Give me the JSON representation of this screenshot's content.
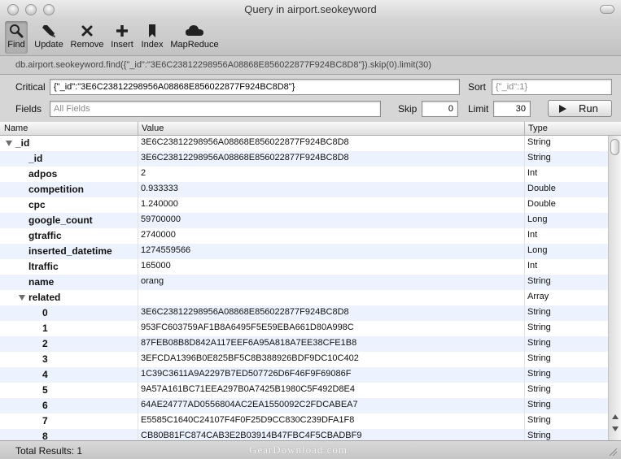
{
  "window": {
    "title": "Query in airport.seokeyword"
  },
  "toolbar": {
    "find": "Find",
    "update": "Update",
    "remove": "Remove",
    "insert": "Insert",
    "index": "Index",
    "mapreduce": "MapReduce"
  },
  "query_line": "db.airport.seokeyword.find({\"_id\":\"3E6C23812298956A08868E856022877F924BC8D8\"}).skip(0).limit(30)",
  "form": {
    "critical_label": "Critical",
    "critical_value": "{\"_id\":\"3E6C23812298956A08868E856022877F924BC8D8\"}",
    "sort_label": "Sort",
    "sort_placeholder": "{\"_id\":1}",
    "fields_label": "Fields",
    "fields_placeholder": "All Fields",
    "skip_label": "Skip",
    "skip_value": "0",
    "limit_label": "Limit",
    "limit_value": "30",
    "run_label": "Run"
  },
  "table": {
    "headers": {
      "name": "Name",
      "value": "Value",
      "type": "Type"
    },
    "rows": [
      {
        "name": "_id",
        "value": "3E6C23812298956A08868E856022877F924BC8D8",
        "type": "String",
        "level": 0,
        "expanded": true
      },
      {
        "name": "_id",
        "value": "3E6C23812298956A08868E856022877F924BC8D8",
        "type": "String",
        "level": 1
      },
      {
        "name": "adpos",
        "value": "2",
        "type": "Int",
        "level": 1
      },
      {
        "name": "competition",
        "value": "0.933333",
        "type": "Double",
        "level": 1
      },
      {
        "name": "cpc",
        "value": "1.240000",
        "type": "Double",
        "level": 1
      },
      {
        "name": "google_count",
        "value": "59700000",
        "type": "Long",
        "level": 1
      },
      {
        "name": "gtraffic",
        "value": "2740000",
        "type": "Int",
        "level": 1
      },
      {
        "name": "inserted_datetime",
        "value": "1274559566",
        "type": "Long",
        "level": 1
      },
      {
        "name": "ltraffic",
        "value": "165000",
        "type": "Int",
        "level": 1
      },
      {
        "name": "name",
        "value": "orang",
        "type": "String",
        "level": 1
      },
      {
        "name": "related",
        "value": "",
        "type": "Array",
        "level": 1,
        "expanded": true
      },
      {
        "name": "0",
        "value": "3E6C23812298956A08868E856022877F924BC8D8",
        "type": "String",
        "level": 2
      },
      {
        "name": "1",
        "value": "953FC603759AF1B8A6495F5E59EBA661D80A998C",
        "type": "String",
        "level": 2
      },
      {
        "name": "2",
        "value": "87FEB08B8D842A117EEF6A95A818A7EE38CFE1B8",
        "type": "String",
        "level": 2
      },
      {
        "name": "3",
        "value": "3EFCDA1396B0E825BF5C8B388926BDF9DC10C402",
        "type": "String",
        "level": 2
      },
      {
        "name": "4",
        "value": "1C39C3611A9A2297B7ED507726D6F46F9F69086F",
        "type": "String",
        "level": 2
      },
      {
        "name": "5",
        "value": "9A57A161BC71EEA297B0A7425B1980C5F492D8E4",
        "type": "String",
        "level": 2
      },
      {
        "name": "6",
        "value": "64AE24777AD0556804AC2EA1550092C2FDCABEA7",
        "type": "String",
        "level": 2
      },
      {
        "name": "7",
        "value": "E5585C1640C24107F4F0F25D9CC830C239DFA1F8",
        "type": "String",
        "level": 2
      },
      {
        "name": "8",
        "value": "CB80B81FC874CAB3E2B03914B47FBC4F5CBADBF9",
        "type": "String",
        "level": 2
      }
    ]
  },
  "status": {
    "total_results": "Total Results: 1",
    "watermark": "GearDownload.com"
  },
  "icons": {
    "find": "magnifier-icon",
    "update": "pen-icon",
    "remove": "x-icon",
    "insert": "plus-icon",
    "index": "bookmark-icon",
    "mapreduce": "cloud-icon",
    "run": "play-icon",
    "disclosure": "disclosure-triangle-icon"
  },
  "colors": {
    "row_stripe": "#edf3fe",
    "selected_tool": "#b0b0b0"
  }
}
